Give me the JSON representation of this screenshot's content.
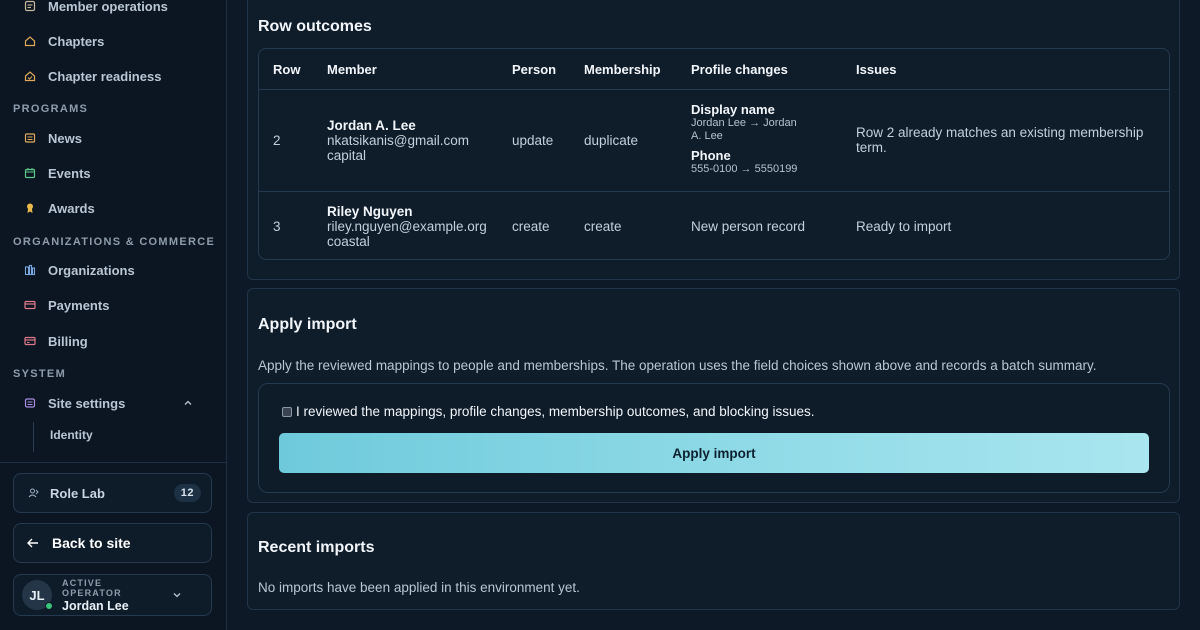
{
  "sidebar": {
    "items_top": [
      {
        "label": "Member operations",
        "icon": "clipboard-icon"
      },
      {
        "label": "Chapters",
        "icon": "home-icon"
      },
      {
        "label": "Chapter readiness",
        "icon": "home-check-icon"
      }
    ],
    "sections": {
      "programs": "PROGRAMS",
      "orgs": "ORGANIZATIONS & COMMERCE",
      "system": "SYSTEM"
    },
    "programs_items": [
      {
        "label": "News",
        "icon": "newspaper-icon"
      },
      {
        "label": "Events",
        "icon": "calendar-icon"
      },
      {
        "label": "Awards",
        "icon": "award-icon"
      }
    ],
    "orgs_items": [
      {
        "label": "Organizations",
        "icon": "buildings-icon"
      },
      {
        "label": "Payments",
        "icon": "credit-card-icon"
      },
      {
        "label": "Billing",
        "icon": "billing-icon"
      }
    ],
    "system_items": [
      {
        "label": "Site settings",
        "icon": "settings-icon"
      }
    ],
    "sub_item": "Identity",
    "role_lab": {
      "label": "Role Lab",
      "count": "12"
    },
    "back_to_site": "Back to site",
    "operator": {
      "label": "ACTIVE OPERATOR",
      "name": "Jordan Lee",
      "initials": "JL"
    }
  },
  "outcomes": {
    "title": "Row outcomes",
    "headers": [
      "Row",
      "Member",
      "Person",
      "Membership",
      "Profile changes",
      "Issues"
    ],
    "rows": [
      {
        "row": "2",
        "name": "Jordan A. Lee",
        "email": "nkatsikanis@gmail.com",
        "chapter": "capital",
        "person": "update",
        "membership": "duplicate",
        "changes": [
          {
            "label": "Display name",
            "line1": "Jordan Lee → Jordan",
            "line2": "A. Lee"
          },
          {
            "label": "Phone",
            "line1": "555-0100 → 5550199"
          }
        ],
        "issue_line1": "Row 2 already matches an existing membership",
        "issue_line2": "term."
      },
      {
        "row": "3",
        "name": "Riley Nguyen",
        "email": "riley.nguyen@example.org",
        "chapter": "coastal",
        "person": "create",
        "membership": "create",
        "change_text": "New person record",
        "issue_line1": "Ready to import"
      }
    ]
  },
  "apply": {
    "title": "Apply import",
    "description": "Apply the reviewed mappings to people and memberships. The operation uses the field choices shown above and records a batch summary.",
    "checkbox_label": "I reviewed the mappings, profile changes, membership outcomes, and blocking issues.",
    "checked": false,
    "button_label": "Apply import"
  },
  "recent": {
    "title": "Recent imports",
    "empty_text": "No imports have been applied in this environment yet."
  },
  "colors": {
    "accent": "#8dd9e6",
    "background": "#0d1926",
    "panel": "#0f1c2a",
    "online": "#3cc47c"
  }
}
